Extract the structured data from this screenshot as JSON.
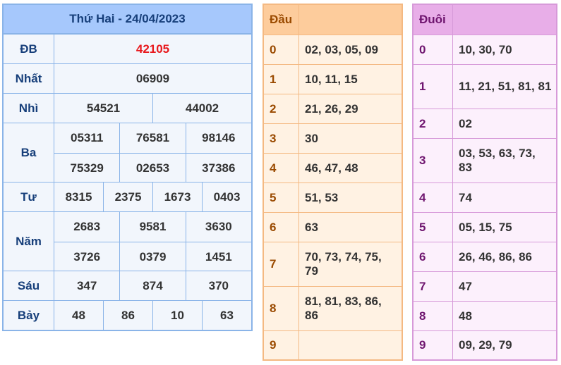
{
  "results": {
    "title": "Thứ Hai - 24/04/2023",
    "prizes": [
      {
        "label": "ĐB",
        "rows": [
          [
            "42105"
          ]
        ],
        "special": true
      },
      {
        "label": "Nhất",
        "rows": [
          [
            "06909"
          ]
        ]
      },
      {
        "label": "Nhì",
        "rows": [
          [
            "54521",
            "44002"
          ]
        ]
      },
      {
        "label": "Ba",
        "rows": [
          [
            "05311",
            "76581",
            "98146"
          ],
          [
            "75329",
            "02653",
            "37386"
          ]
        ]
      },
      {
        "label": "Tư",
        "rows": [
          [
            "8315",
            "2375",
            "1673",
            "0403"
          ]
        ]
      },
      {
        "label": "Năm",
        "rows": [
          [
            "2683",
            "9581",
            "3630"
          ],
          [
            "3726",
            "0379",
            "1451"
          ]
        ]
      },
      {
        "label": "Sáu",
        "rows": [
          [
            "347",
            "874",
            "370"
          ]
        ]
      },
      {
        "label": "Bảy",
        "rows": [
          [
            "48",
            "86",
            "10",
            "63"
          ]
        ]
      }
    ]
  },
  "dau": {
    "header": "Đầu",
    "rows": [
      {
        "key": "0",
        "value": "02, 03, 05, 09"
      },
      {
        "key": "1",
        "value": "10, 11, 15"
      },
      {
        "key": "2",
        "value": "21, 26, 29"
      },
      {
        "key": "3",
        "value": "30"
      },
      {
        "key": "4",
        "value": "46, 47, 48"
      },
      {
        "key": "5",
        "value": "51, 53"
      },
      {
        "key": "6",
        "value": "63"
      },
      {
        "key": "7",
        "value": "70, 73, 74, 75, 79"
      },
      {
        "key": "8",
        "value": "81, 81, 83, 86, 86"
      },
      {
        "key": "9",
        "value": ""
      }
    ]
  },
  "duoi": {
    "header": "Đuôi",
    "rows": [
      {
        "key": "0",
        "value": "10, 30, 70"
      },
      {
        "key": "1",
        "value": "11, 21, 51, 81, 81"
      },
      {
        "key": "2",
        "value": "02"
      },
      {
        "key": "3",
        "value": "03, 53, 63, 73, 83"
      },
      {
        "key": "4",
        "value": "74"
      },
      {
        "key": "5",
        "value": "05, 15, 75"
      },
      {
        "key": "6",
        "value": "26, 46, 86, 86"
      },
      {
        "key": "7",
        "value": "47"
      },
      {
        "key": "8",
        "value": "48"
      },
      {
        "key": "9",
        "value": "09, 29, 79"
      }
    ]
  },
  "colors": {
    "special_number": "#e8181c",
    "results_header_bg": "#a6c8fc",
    "dau_header_bg": "#fdcc9c",
    "duoi_header_bg": "#e8aee8"
  }
}
